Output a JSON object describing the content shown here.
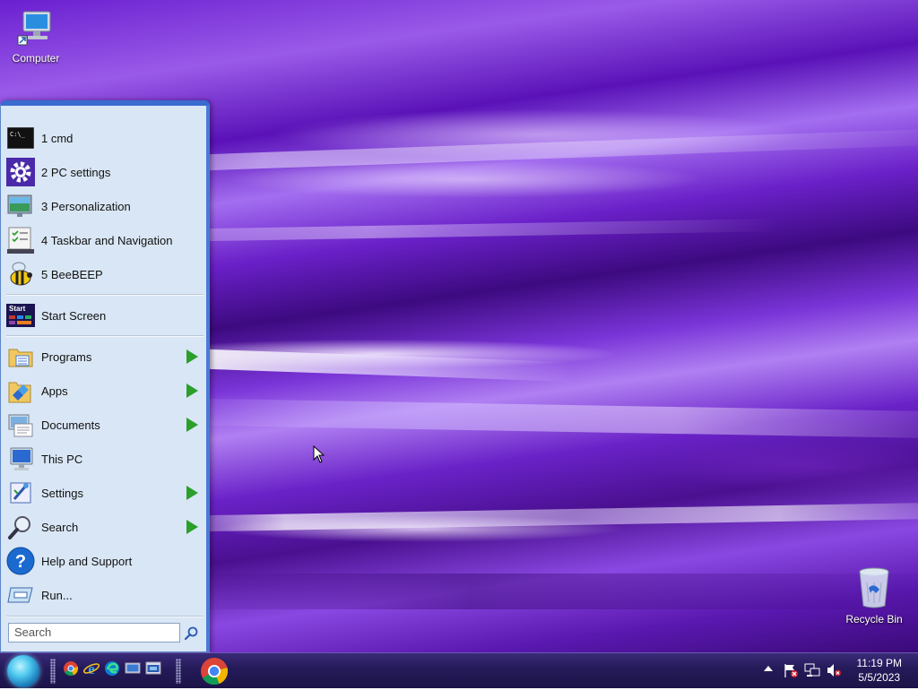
{
  "desktop": {
    "icons": [
      {
        "name": "computer",
        "label": "Computer"
      },
      {
        "name": "recycle-bin",
        "label": "Recycle Bin"
      }
    ]
  },
  "start_menu": {
    "recent": [
      {
        "label": "1 cmd",
        "icon": "cmd-icon"
      },
      {
        "label": "2 PC settings",
        "icon": "gear-icon"
      },
      {
        "label": "3 Personalization",
        "icon": "personalization-icon"
      },
      {
        "label": "4 Taskbar and Navigation",
        "icon": "taskbar-icon"
      },
      {
        "label": "5 BeeBEEP",
        "icon": "bee-icon"
      }
    ],
    "start_screen": {
      "label": "Start Screen",
      "icon_text": "Start"
    },
    "places": [
      {
        "label": "Programs",
        "icon": "programs-folder-icon",
        "submenu": true
      },
      {
        "label": "Apps",
        "icon": "apps-icon",
        "submenu": true
      },
      {
        "label": "Documents",
        "icon": "documents-icon",
        "submenu": true
      },
      {
        "label": "This PC",
        "icon": "this-pc-icon",
        "submenu": false
      },
      {
        "label": "Settings",
        "icon": "settings-icon",
        "submenu": true
      },
      {
        "label": "Search",
        "icon": "search-icon",
        "submenu": true
      },
      {
        "label": "Help and Support",
        "icon": "help-icon",
        "submenu": false
      },
      {
        "label": "Run...",
        "icon": "run-icon",
        "submenu": false
      }
    ],
    "search_placeholder": "Search"
  },
  "taskbar": {
    "pinned": [
      "chrome-icon",
      "internet-explorer-icon",
      "edge-icon",
      "desktop-icon",
      "network-window-icon"
    ],
    "running": [
      "chrome-icon"
    ],
    "tray": [
      "show-hidden-icons",
      "action-center-flag-icon",
      "network-icon",
      "volume-muted-icon"
    ],
    "clock": {
      "time": "11:19 PM",
      "date": "5/5/2023"
    }
  },
  "colors": {
    "accent": "#3a6bd1",
    "submenu_arrow": "#2aa02a",
    "menu_bg": "#d9e6f5",
    "taskbar": "#241a58"
  }
}
